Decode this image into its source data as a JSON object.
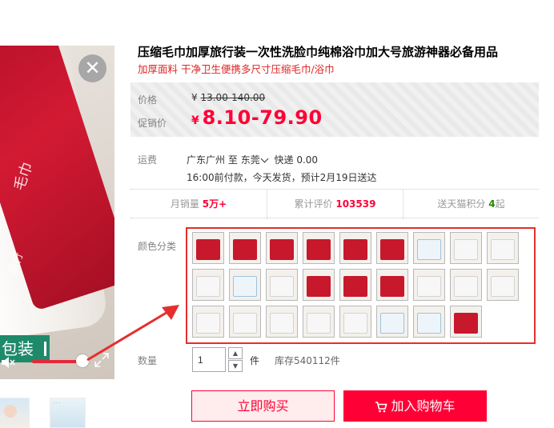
{
  "product": {
    "title": "压缩毛巾加厚旅行装一次性洗脸巾纯棉浴巾加大号旅游神器必备用品",
    "subtitle": "加厚面料 干净卫生便携多尺寸压缩毛巾/浴巾"
  },
  "price": {
    "original_label": "价格",
    "original_currency": "¥",
    "original_value": "13.00-140.00",
    "promo_label": "促销价",
    "promo_currency": "¥",
    "promo_value": "8.10-79.90"
  },
  "shipping": {
    "label": "运费",
    "from": "广东广州",
    "to_word": "至",
    "to": "东莞",
    "method": "快递 0.00",
    "eta": "16:00前付款，今天发货，预计2月19日送达"
  },
  "stats": {
    "monthly_label": "月销量",
    "monthly_value": "5万+",
    "reviews_label": "累计评价",
    "reviews_value": "103539",
    "points_label": "送天猫积分",
    "points_value": "4",
    "points_unit": "起"
  },
  "sku": {
    "label": "颜色分类",
    "items": [
      {
        "color": "red"
      },
      {
        "color": "red"
      },
      {
        "color": "red"
      },
      {
        "color": "red"
      },
      {
        "color": "red"
      },
      {
        "color": "red"
      },
      {
        "color": "blue"
      },
      {
        "color": "white"
      },
      {
        "color": "white"
      },
      {
        "color": "white"
      },
      {
        "color": "blue"
      },
      {
        "color": "white"
      },
      {
        "color": "red"
      },
      {
        "color": "red"
      },
      {
        "color": "red"
      },
      {
        "color": "white"
      },
      {
        "color": "white"
      },
      {
        "color": "white"
      },
      {
        "color": "white"
      },
      {
        "color": "white"
      },
      {
        "color": "white"
      },
      {
        "color": "white"
      },
      {
        "color": "white"
      },
      {
        "color": "blue"
      },
      {
        "color": "blue"
      },
      {
        "color": "red"
      }
    ]
  },
  "quantity": {
    "label": "数量",
    "value": "1",
    "unit": "件",
    "stock": "库存540112件"
  },
  "actions": {
    "buy_now": "立即购买",
    "add_cart": "加入购物车"
  },
  "media": {
    "label_text": "包装"
  },
  "colors": {
    "accent": "#ff0036",
    "highlight": "#e62e2e",
    "subtitle": "#dd2727"
  }
}
